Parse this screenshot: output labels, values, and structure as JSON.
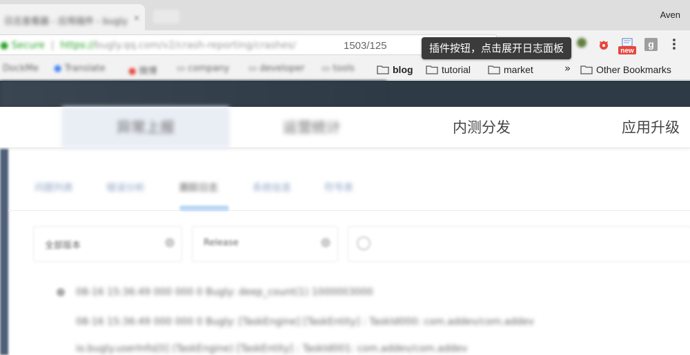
{
  "browser": {
    "tab_title": "日志查看器 - 应用插件 - bugly",
    "tab_close": "×",
    "profile_name": "Aven",
    "url_prefix": "Secure",
    "url_scheme": "https://",
    "url_host": "bugly.qq.com",
    "url_path_blurred": "/v2/crash-reporting/crashes/",
    "url_tail": "1503/125",
    "tooltip": "插件按钮，点击展开日志面板",
    "ext_new_badge": "new",
    "ext_g_label": "g"
  },
  "bookmarks": {
    "blurred": [
      "DockMe",
      "Translate",
      "微博",
      "company",
      "developer",
      "tools"
    ],
    "items": [
      {
        "label": "blog",
        "bold": true
      },
      {
        "label": "tutorial",
        "bold": false
      },
      {
        "label": "market",
        "bold": false
      }
    ],
    "overflow": "»",
    "other": "Other Bookmarks"
  },
  "nav": {
    "items": [
      "异常上报",
      "运营统计",
      "内测分发",
      "应用升级"
    ]
  },
  "subtabs": {
    "items": [
      "问题列表",
      "错误分析",
      "跟踪日志",
      "系统信息",
      "符号表"
    ]
  },
  "filters": {
    "version": "全部版本",
    "status": "Release"
  },
  "logs": [
    "08-16 15:36:49 000 000 0 Bugly: deep_count(1) 1000003000",
    "08-16 15:36:49 000 000 0 Bugly: [TaskEngine] [TaskEntity] : TaskId000: com.addev/com.addev",
    "io.bugly.userInfo[0] (TaskEngine) [TaskEntity] : TaskId001: com.addev/com.addev"
  ],
  "colors": {
    "page_topbar": "#2e3a46",
    "tooltip_bg": "#3b3b3b",
    "new_badge": "#e8453c"
  }
}
